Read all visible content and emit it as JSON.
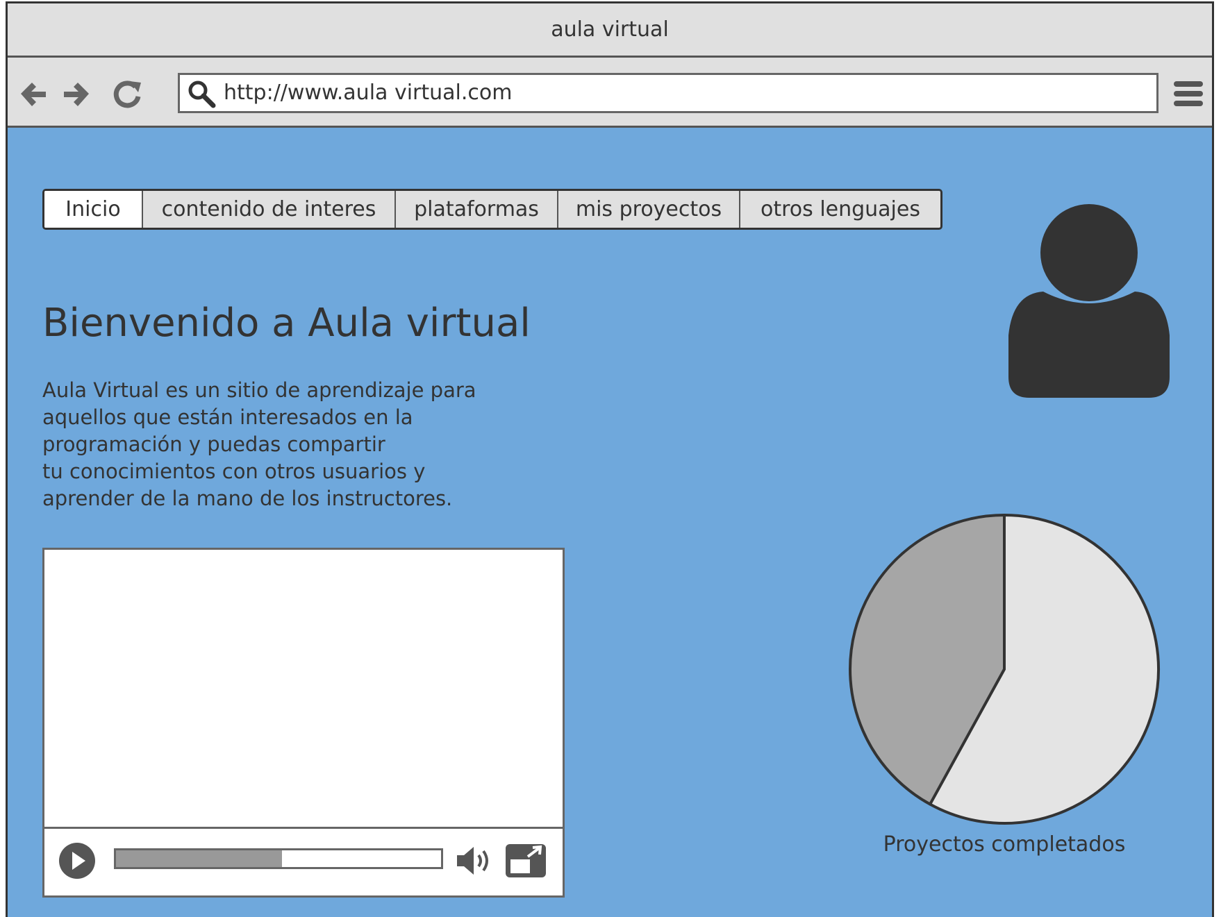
{
  "window": {
    "title": "aula virtual"
  },
  "toolbar": {
    "url": "http://www.aula virtual.com"
  },
  "nav": {
    "tabs": [
      {
        "label": "Inicio",
        "active": true
      },
      {
        "label": "contenido de interes",
        "active": false
      },
      {
        "label": "plataformas",
        "active": false
      },
      {
        "label": "mis proyectos",
        "active": false
      },
      {
        "label": "otros lenguajes",
        "active": false
      }
    ]
  },
  "main": {
    "heading": "Bienvenido a Aula virtual",
    "description_lines": [
      "Aula Virtual es un sitio de aprendizaje para",
      "aquellos que están interesados en la",
      "programación y puedas compartir",
      "tu conocimientos con otros usuarios y",
      "aprender de la mano de los instructores."
    ]
  },
  "video": {
    "progress": 0.51
  },
  "chart": {
    "label": "Proyectos completados"
  },
  "chart_data": {
    "type": "pie",
    "values": [
      58,
      42
    ],
    "colors": [
      "#e4e4e4",
      "#a6a6a6"
    ],
    "caption": "Proyectos completados"
  },
  "colors": {
    "page_background": "#6fa8dc",
    "chrome": "#e0e0e0",
    "ink": "#333333"
  },
  "icons": [
    "back-arrow-icon",
    "forward-arrow-icon",
    "reload-icon",
    "search-icon",
    "hamburger-menu-icon",
    "user-avatar-icon",
    "play-icon",
    "volume-icon",
    "fullscreen-icon"
  ]
}
